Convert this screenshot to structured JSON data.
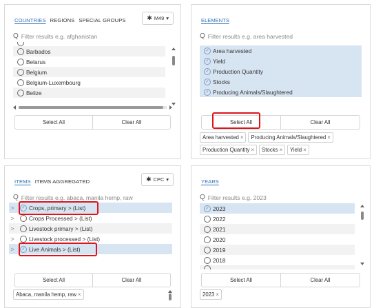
{
  "countries": {
    "tabs": [
      {
        "label": "COUNTRIES",
        "active": true
      },
      {
        "label": "REGIONS",
        "active": false
      },
      {
        "label": "SPECIAL GROUPS",
        "active": false
      }
    ],
    "code_button": "M49",
    "search_placeholder": "Filter results  e.g. afghanistan",
    "items": [
      {
        "label": "Barbados",
        "selected": false
      },
      {
        "label": "Belarus",
        "selected": false
      },
      {
        "label": "Belgium",
        "selected": false
      },
      {
        "label": "Belgium-Luxembourg",
        "selected": false
      },
      {
        "label": "Belize",
        "selected": false
      }
    ],
    "select_all": "Select All",
    "clear_all": "Clear All"
  },
  "elements": {
    "title": "ELEMENTS",
    "search_placeholder": "Filter results  e.g. area harvested",
    "items": [
      {
        "label": "Area harvested",
        "selected": true
      },
      {
        "label": "Yield",
        "selected": true
      },
      {
        "label": "Production Quantity",
        "selected": true
      },
      {
        "label": "Stocks",
        "selected": true
      },
      {
        "label": "Producing Animals/Slaughtered",
        "selected": true
      }
    ],
    "select_all": "Select All",
    "clear_all": "Clear All",
    "chips": [
      "Area harvested",
      "Producing Animals/Slaughtered",
      "Production Quantity",
      "Stocks",
      "Yield"
    ]
  },
  "items_panel": {
    "tabs": [
      {
        "label": "ITEMS",
        "active": true
      },
      {
        "label": "ITEMS AGGREGATED",
        "active": false
      }
    ],
    "code_button": "CPC",
    "search_placeholder": "Filter results  e.g. abaca, manila hemp, raw",
    "items": [
      {
        "label": "Crops, primary > (List)",
        "selected": true
      },
      {
        "label": "Crops Processed > (List)",
        "selected": false
      },
      {
        "label": "Livestock primary > (List)",
        "selected": false
      },
      {
        "label": "Livestock processed > (List)",
        "selected": false
      },
      {
        "label": "Live Animals > (List)",
        "selected": true
      }
    ],
    "select_all": "Select All",
    "clear_all": "Clear All",
    "chips": [
      "Abaca, manila hemp, raw"
    ]
  },
  "years": {
    "title": "YEARS",
    "search_placeholder": "Filter results  e.g. 2023",
    "items": [
      {
        "label": "2023",
        "selected": true
      },
      {
        "label": "2022",
        "selected": false
      },
      {
        "label": "2021",
        "selected": false
      },
      {
        "label": "2020",
        "selected": false
      },
      {
        "label": "2019",
        "selected": false
      },
      {
        "label": "2018",
        "selected": false
      }
    ],
    "select_all": "Select All",
    "clear_all": "Clear All",
    "chips": [
      "2023"
    ]
  },
  "glyphs": {
    "close": "×",
    "caret_right": ">",
    "check": "✓",
    "dropdown": "▾",
    "gear": "✱",
    "search": "Q"
  },
  "colors": {
    "accent": "#2f6fb5",
    "selected_row": "#d7e4f2",
    "highlight": "#e0131b"
  }
}
